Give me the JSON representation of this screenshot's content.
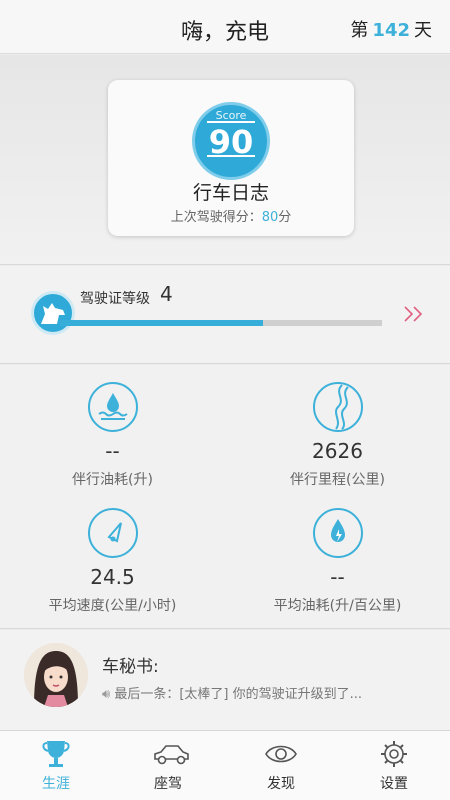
{
  "header": {
    "title": "嗨，充电",
    "day_prefix": "第",
    "day_count": "142",
    "day_suffix": "天"
  },
  "score_card": {
    "badge_label": "Score",
    "score": "90",
    "name": "行车日志",
    "last_prefix": "上次驾驶得分：",
    "last_score": "80",
    "last_suffix": "分"
  },
  "license_level": {
    "label": "驾驶证等级",
    "value": "4",
    "progress": 0.63,
    "more_icon": "double-chevron-right-icon"
  },
  "stats": [
    {
      "value": "--",
      "label": "伴行油耗(升)",
      "icon": "fuel-drop-icon"
    },
    {
      "value": "2626",
      "label": "伴行里程(公里)",
      "icon": "road-icon"
    },
    {
      "value": "24.5",
      "label": "平均速度(公里/小时)",
      "icon": "speedometer-icon"
    },
    {
      "value": "--",
      "label": "平均油耗(升/百公里)",
      "icon": "flame-drop-icon"
    }
  ],
  "secretary": {
    "title": "车秘书:",
    "message": "最后一条：[太棒了] 你的驾驶证升级到了..."
  },
  "tabs": [
    {
      "label": "生涯",
      "icon": "trophy-icon",
      "active": true
    },
    {
      "label": "座驾",
      "icon": "car-icon",
      "active": false
    },
    {
      "label": "发现",
      "icon": "eye-icon",
      "active": false
    },
    {
      "label": "设置",
      "icon": "gear-icon",
      "active": false
    }
  ],
  "colors": {
    "accent": "#3db1d9",
    "chevron": "#e06080",
    "background": "#ececec"
  }
}
